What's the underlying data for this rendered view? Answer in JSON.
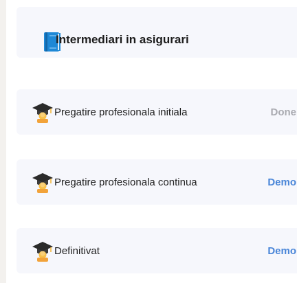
{
  "header": {
    "title": "Intermediari in asigurari",
    "icon": "book-icon"
  },
  "rows": [
    {
      "label": "Pregatire profesionala initiala",
      "action": "Done",
      "action_color": "#a9aab0",
      "icon": "graduation-cap-icon"
    },
    {
      "label": "Pregatire profesionala continua",
      "action": "Demo",
      "action_color": "#4a86d8",
      "icon": "graduation-cap-icon"
    },
    {
      "label": "Definitivat",
      "action": "Demo",
      "action_color": "#4a86d8",
      "icon": "graduation-cap-icon"
    }
  ]
}
